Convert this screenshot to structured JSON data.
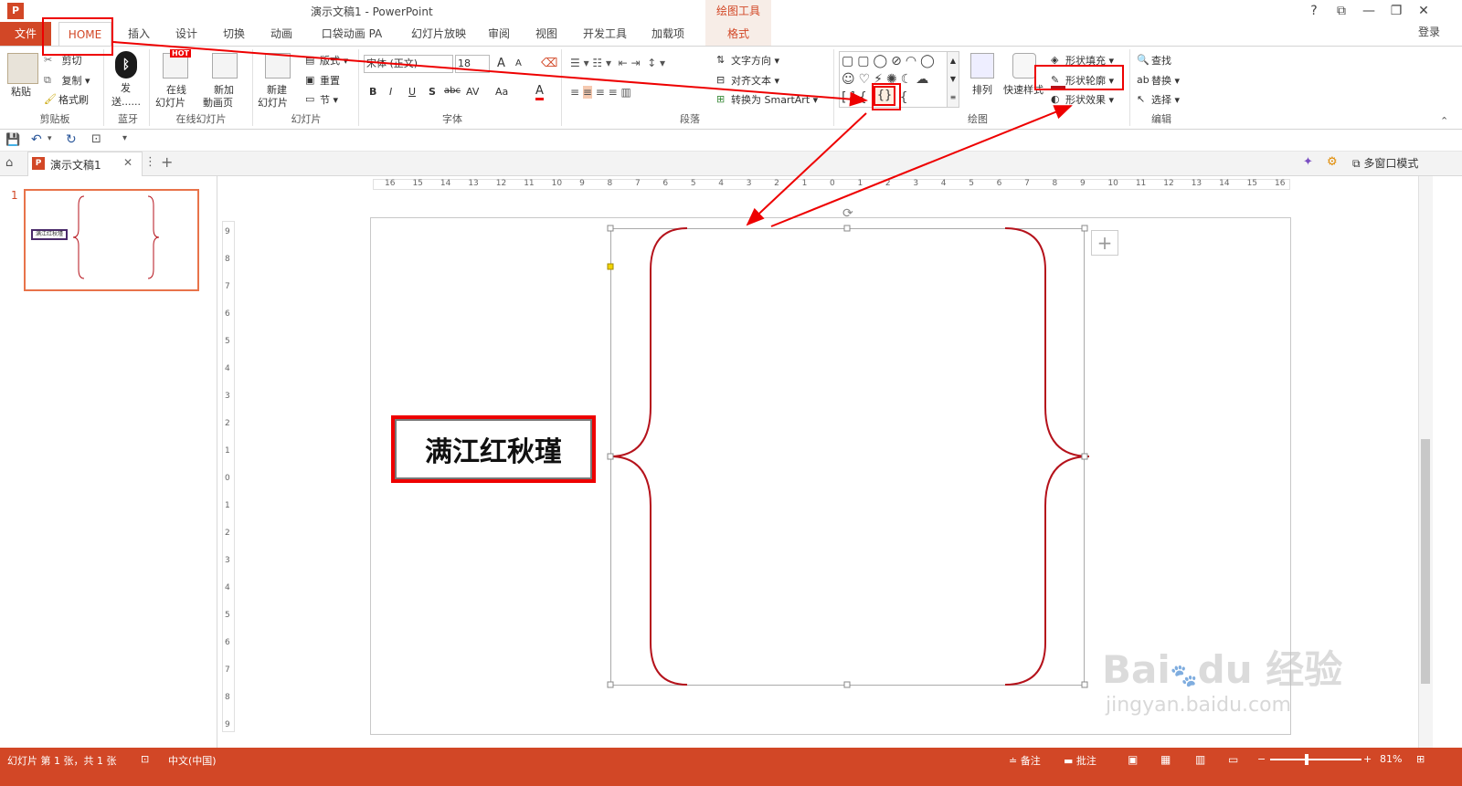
{
  "title_bar": {
    "title": "演示文稿1 - PowerPoint",
    "contextual_tab": "绘图工具",
    "help": "?",
    "restore_ribbon": "⧉",
    "minimize": "—",
    "maximize": "❐",
    "close": "✕",
    "login": "登录"
  },
  "tabs": {
    "file": "文件",
    "home": "HOME",
    "insert": "插入",
    "design": "设计",
    "transitions": "切换",
    "animations": "动画",
    "pocket_anim": "口袋动画 PA",
    "slideshow": "幻灯片放映",
    "review": "审阅",
    "view": "视图",
    "developer": "开发工具",
    "addins": "加载项",
    "format": "格式"
  },
  "ribbon": {
    "clipboard": {
      "paste": "粘贴",
      "cut": "剪切",
      "copy": "复制",
      "format_painter": "格式刷",
      "label": "剪贴板"
    },
    "bluetooth": {
      "send": "发",
      "send2": "送......",
      "label": "蓝牙"
    },
    "online": {
      "online_slides": "在线",
      "online_slides2": "幻灯片",
      "new_page": "新加",
      "new_page2": "動画页",
      "hot": "HOT",
      "label": "在线幻灯片"
    },
    "slides": {
      "new_slide": "新建",
      "new_slide2": "幻灯片",
      "layout": "版式",
      "reset": "重置",
      "section": "节",
      "label": "幻灯片"
    },
    "font": {
      "name": "宋体 (正文)",
      "size": "18",
      "bold": "B",
      "italic": "I",
      "underline": "U",
      "shadow": "S",
      "strike": "abc",
      "spacing": "AV",
      "case": "Aa",
      "color": "A",
      "grow": "A",
      "shrink": "A",
      "label": "字体"
    },
    "paragraph": {
      "text_direction": "文字方向",
      "align_text": "对齐文本",
      "smartart": "转换为 SmartArt",
      "label": "段落"
    },
    "drawing": {
      "arrange": "排列",
      "quick_styles": "快速样式",
      "shape_fill": "形状填充",
      "shape_outline": "形状轮廓",
      "shape_effects": "形状效果",
      "label": "绘图"
    },
    "editing": {
      "find": "查找",
      "replace": "替换",
      "select": "选择",
      "label": "编辑"
    }
  },
  "doc_tab": {
    "name": "演示文稿1",
    "multi_window": "多窗口模式"
  },
  "ruler": {
    "h_ticks": [
      "16",
      "15",
      "14",
      "13",
      "12",
      "11",
      "10",
      "9",
      "8",
      "7",
      "6",
      "5",
      "4",
      "3",
      "2",
      "1",
      "0",
      "1",
      "2",
      "3",
      "4",
      "5",
      "6",
      "7",
      "8",
      "9",
      "10",
      "11",
      "12",
      "13",
      "14",
      "15",
      "16"
    ],
    "v_ticks": [
      "9",
      "8",
      "7",
      "6",
      "5",
      "4",
      "3",
      "2",
      "1",
      "0",
      "1",
      "2",
      "3",
      "4",
      "5",
      "6",
      "7",
      "8",
      "9"
    ]
  },
  "slide": {
    "number": "1",
    "title_text": "满江红秋瑾",
    "thumb_text": "满江红秋瑾"
  },
  "watermark": {
    "brand": "Bai",
    "brand2": "du",
    "cn": "经验",
    "url": "jingyan.baidu.com"
  },
  "status": {
    "slide_info": "幻灯片 第 1 张，共 1 张",
    "language": "中文(中国)",
    "notes": "备注",
    "comments": "批注",
    "zoom": "81%"
  },
  "colors": {
    "accent": "#d24726",
    "annotation": "#e00000",
    "brace": "#b5121b"
  }
}
